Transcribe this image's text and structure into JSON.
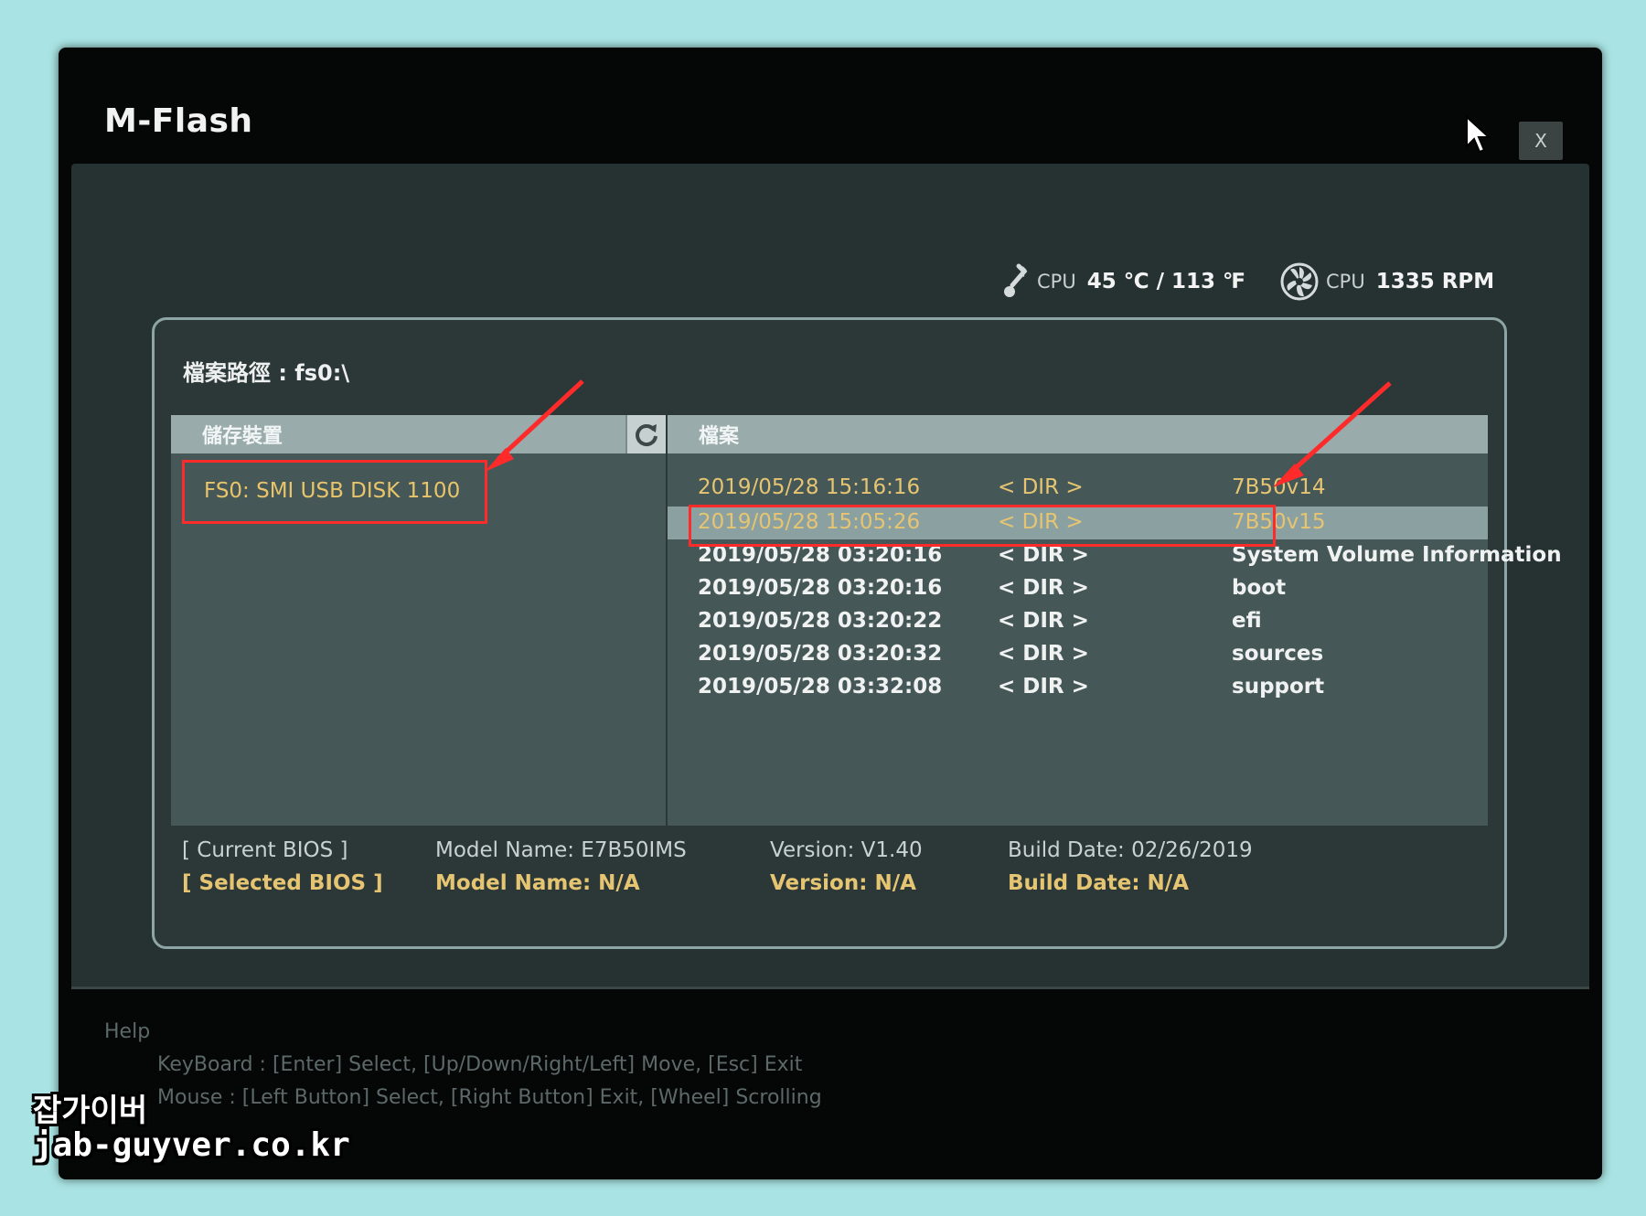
{
  "window": {
    "title": "M-Flash",
    "close_label": "X"
  },
  "sensors": {
    "cpu_temp_label": "CPU",
    "cpu_temp_value": "45 ℃ / 113 ℉",
    "cpu_fan_label": "CPU",
    "cpu_fan_value": "1335 RPM"
  },
  "path": {
    "text": "檔案路徑 : fs0:\\"
  },
  "devices": {
    "header": "儲存裝置",
    "items": [
      {
        "label": "FS0: SMI USB DISK 1100"
      }
    ]
  },
  "files": {
    "header": "檔案",
    "rows": [
      {
        "date": "2019/05/28 15:16:16",
        "type": "< DIR >",
        "name": "7B50v14"
      },
      {
        "date": "2019/05/28 15:05:26",
        "type": "< DIR >",
        "name": "7B50v15"
      },
      {
        "date": "2019/05/28 03:20:16",
        "type": "< DIR >",
        "name": "System Volume Information"
      },
      {
        "date": "2019/05/28 03:20:16",
        "type": "< DIR >",
        "name": "boot"
      },
      {
        "date": "2019/05/28 03:20:22",
        "type": "< DIR >",
        "name": "efi"
      },
      {
        "date": "2019/05/28 03:20:32",
        "type": "< DIR >",
        "name": "sources"
      },
      {
        "date": "2019/05/28 03:32:08",
        "type": "< DIR >",
        "name": "support"
      }
    ]
  },
  "bios": {
    "current": {
      "label": "[ Current BIOS   ]",
      "model": "Model Name: E7B50IMS",
      "version": "Version: V1.40",
      "build_date": "Build Date: 02/26/2019"
    },
    "selected": {
      "label": "[ Selected BIOS ]",
      "model": "Model Name: N/A",
      "version": "Version: N/A",
      "build_date": "Build Date: N/A"
    }
  },
  "help": {
    "title": "Help",
    "keyboard": "KeyBoard :   [Enter]  Select,   [Up/Down/Right/Left]  Move,   [Esc]  Exit",
    "mouse": "Mouse     :   [Left Button]  Select,   [Right Button]  Exit,   [Wheel]  Scrolling"
  },
  "watermark": {
    "line1": "잡가이버",
    "line2": "jab-guyver.co.kr"
  },
  "colors": {
    "highlight_text": "#e6c572",
    "annotation": "#ff2a2a"
  }
}
